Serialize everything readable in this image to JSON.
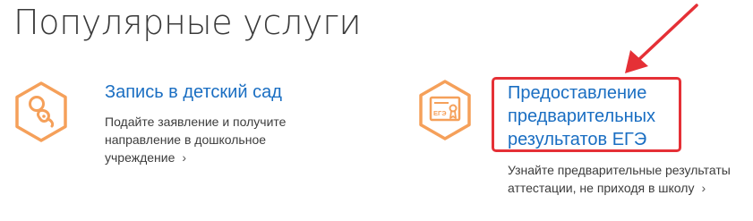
{
  "page": {
    "title": "Популярные услуги"
  },
  "services": [
    {
      "title": "Запись в детский сад",
      "description": "Подайте заявление и получите направление в дошкольное учреждение",
      "icon": "pacifier-icon",
      "chevron": "›"
    },
    {
      "title": "Предоставление предварительных результатов ЕГЭ",
      "description": "Узнайте предварительные результаты аттестации, не приходя в школу",
      "icon": "certificate-icon",
      "icon_label": "ЕГЭ",
      "chevron": "›"
    }
  ],
  "colors": {
    "icon_orange": "#f5a05a",
    "link_blue": "#1a6ec2",
    "highlight_red": "#e53036"
  }
}
